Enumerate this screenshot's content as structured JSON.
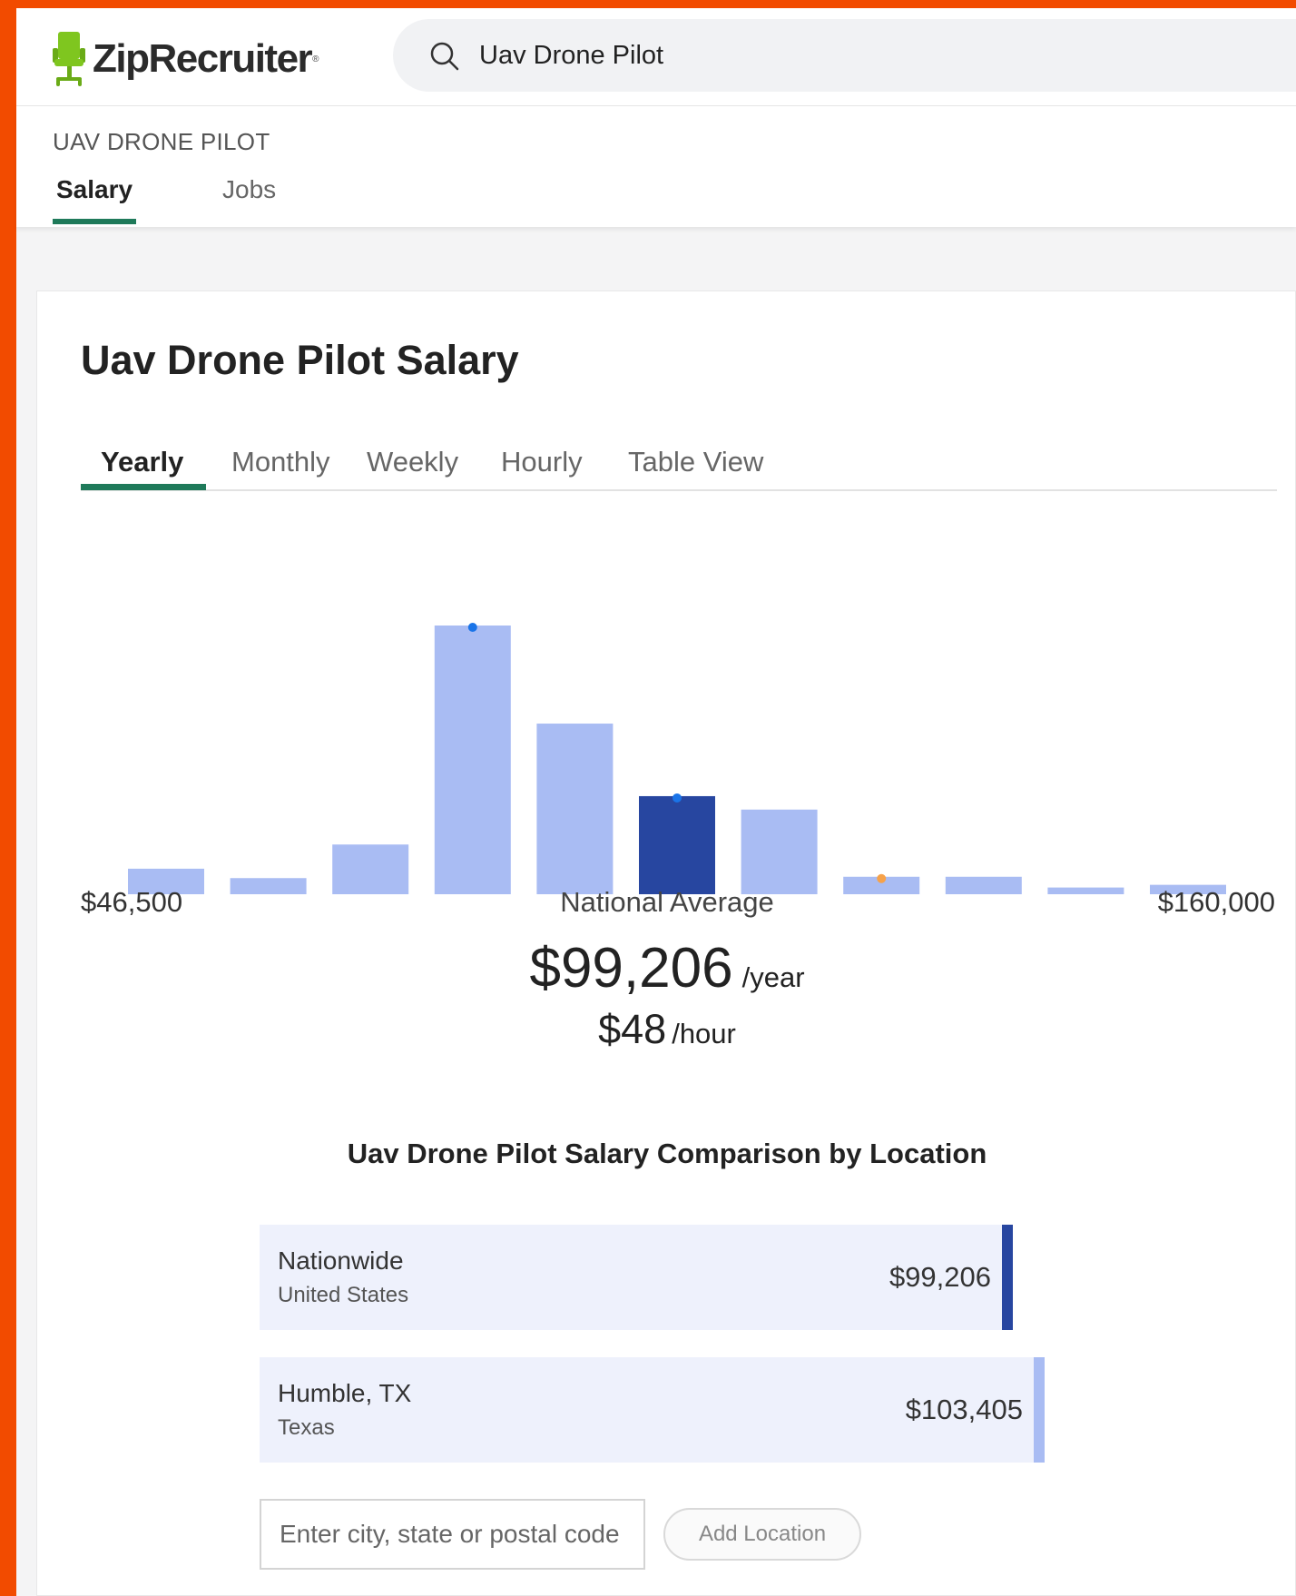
{
  "colors": {
    "frame": "#f24b00",
    "accent_green": "#1f7a5a",
    "bar_light": "#a9bcf3",
    "bar_dark": "#2746a0",
    "dot_blue": "#1a74e8",
    "dot_orange": "#f6a24a",
    "row_bg": "#eef1fc"
  },
  "header": {
    "logo_text": "ZipRecruiter",
    "logo_reg": "®",
    "search_value": "Uav Drone Pilot"
  },
  "subnav": {
    "breadcrumb": "UAV DRONE PILOT",
    "tabs": [
      {
        "label": "Salary",
        "active": true
      },
      {
        "label": "Jobs",
        "active": false
      }
    ]
  },
  "main": {
    "title": "Uav Drone Pilot Salary",
    "tabs": [
      {
        "label": "Yearly",
        "active": true
      },
      {
        "label": "Monthly",
        "active": false
      },
      {
        "label": "Weekly",
        "active": false
      },
      {
        "label": "Hourly",
        "active": false
      },
      {
        "label": "Table View",
        "active": false
      }
    ],
    "range_min": "$46,500",
    "range_mid_label": "National Average",
    "range_max": "$160,000",
    "avg_yearly": "$99,206",
    "avg_yearly_unit": "/year",
    "avg_hourly": "$48",
    "avg_hourly_unit": "/hour",
    "comparison_title": "Uav Drone Pilot Salary Comparison by Location",
    "locations": [
      {
        "name": "Nationwide",
        "sub": "United States",
        "value": "$99,206",
        "amount": 99206
      },
      {
        "name": "Humble, TX",
        "sub": "Texas",
        "value": "$103,405",
        "amount": 103405
      }
    ],
    "location_input_placeholder": "Enter city, state or postal code",
    "add_location_label": "Add Location"
  },
  "chart_data": {
    "type": "bar",
    "x_min": 46500,
    "x_max": 160000,
    "values": [
      9.5,
      6,
      18.5,
      100,
      63.5,
      36.5,
      31.5,
      6.5,
      6.5,
      2.5,
      3.5
    ],
    "highlight_index": 5,
    "markers": [
      {
        "bin": 3,
        "color": "dot_blue"
      },
      {
        "bin": 5,
        "color": "dot_blue"
      },
      {
        "bin": 7,
        "color": "dot_orange"
      }
    ]
  }
}
